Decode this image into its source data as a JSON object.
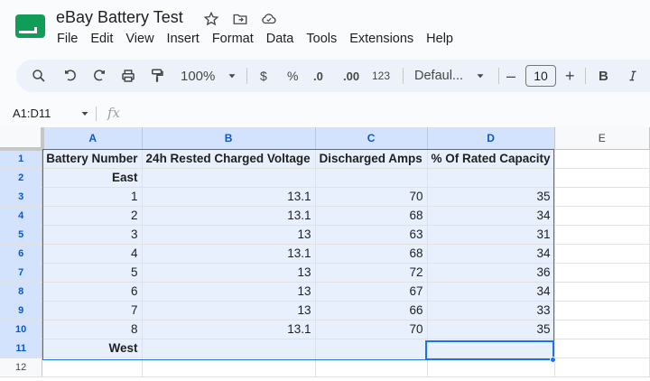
{
  "app": {
    "title": "eBay Battery Test",
    "menu": [
      "File",
      "Edit",
      "View",
      "Insert",
      "Format",
      "Data",
      "Tools",
      "Extensions",
      "Help"
    ]
  },
  "toolbar": {
    "zoom": "100%",
    "currency": "$",
    "percent": "%",
    "decrease_decimal": ".0",
    "increase_decimal": ".00",
    "number_format": "123",
    "font": "Defaul...",
    "font_size": "10",
    "minus": "–",
    "plus": "+",
    "bold": "B"
  },
  "formula_bar": {
    "name_box": "A1:D11",
    "fx": "fx"
  },
  "sheet": {
    "columns": [
      "A",
      "B",
      "C",
      "D",
      "E"
    ],
    "row_numbers": [
      "1",
      "2",
      "3",
      "4",
      "5",
      "6",
      "7",
      "8",
      "9",
      "10",
      "11",
      "12"
    ],
    "rows": [
      [
        "Battery Number",
        "24h Rested Charged Voltage",
        "Discharged Amps",
        "% Of Rated Capacity",
        ""
      ],
      [
        "East",
        "",
        "",
        "",
        ""
      ],
      [
        "1",
        "13.1",
        "70",
        "35",
        ""
      ],
      [
        "2",
        "13.1",
        "68",
        "34",
        ""
      ],
      [
        "3",
        "13",
        "63",
        "31",
        ""
      ],
      [
        "4",
        "13.1",
        "68",
        "34",
        ""
      ],
      [
        "5",
        "13",
        "72",
        "36",
        ""
      ],
      [
        "6",
        "13",
        "67",
        "34",
        ""
      ],
      [
        "7",
        "13",
        "66",
        "33",
        ""
      ],
      [
        "8",
        "13.1",
        "70",
        "35",
        ""
      ],
      [
        "West",
        "",
        "",
        "",
        ""
      ],
      [
        "",
        "",
        "",
        "",
        ""
      ]
    ]
  },
  "colors": {
    "accent": "#1a73e8",
    "selection_fill": "#e8f0fe",
    "header_selected": "#d3e3fd",
    "logo_green": "#0f9d58"
  }
}
